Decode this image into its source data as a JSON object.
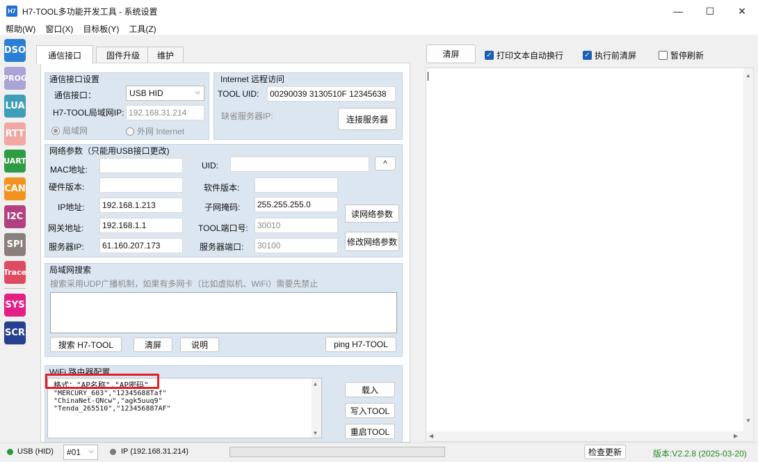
{
  "window": {
    "icon_text": "H7",
    "title": "H7-TOOL多功能开发工具 - 系统设置",
    "minimize": "—",
    "maximize": "☐",
    "close": "✕"
  },
  "menu": [
    "帮助(W)",
    "窗口(X)",
    "目标板(Y)",
    "工具(Z)"
  ],
  "sidebar": [
    {
      "label": "DSO",
      "color": "#2a7fd4"
    },
    {
      "label": "PROG",
      "color": "#a9a3d6"
    },
    {
      "label": "LUA",
      "color": "#3f9fb6"
    },
    {
      "label": "RTT",
      "color": "#f1a7a3"
    },
    {
      "label": "UART",
      "color": "#2f9c44"
    },
    {
      "label": "CAN",
      "color": "#f3931f"
    },
    {
      "label": "I2C",
      "color": "#b4417f"
    },
    {
      "label": "SPI",
      "color": "#8b7f7d"
    },
    {
      "label": "Trace",
      "color": "#e04a61"
    },
    {
      "label": "SYS",
      "color": "#e21f86"
    },
    {
      "label": "SCR",
      "color": "#273f8f"
    }
  ],
  "tabs": [
    "通信接口",
    "固件升级",
    "维护"
  ],
  "comm": {
    "title": "通信接口设置",
    "iface_label": "通信接口：",
    "iface_value": "USB HID",
    "lan_ip_label": "H7-TOOL局域网IP:",
    "lan_ip_value": "192.168.31.214",
    "radio_lan": "局域网",
    "radio_wan": "外网 Internet"
  },
  "internet": {
    "title": "Internet 远程访问",
    "uid_label": "TOOL UID:",
    "uid_value": "00290039 3130510F 12345638",
    "server_label": "缺省服务器IP:",
    "connect_button": "连接服务器"
  },
  "net": {
    "title": "网络参数（只能用USB接口更改)",
    "mac_label": "MAC地址:",
    "mac_value": "",
    "uid_label": "UID:",
    "uid_value": "",
    "uid_button": "^",
    "hw_label": "硬件版本:",
    "hw_value": "",
    "sw_label": "软件版本:",
    "sw_value": "",
    "ip_label": "IP地址:",
    "ip_value": "192.168.1.213",
    "mask_label": "子网掩码:",
    "mask_value": "255.255.255.0",
    "read_button": "读网络参数",
    "gw_label": "网关地址:",
    "gw_value": "192.168.1.1",
    "port_label": "TOOL端口号:",
    "port_value": "30010",
    "server_ip_label": "服务器IP:",
    "server_ip_value": "61.160.207.173",
    "server_port_label": "服务器端口:",
    "server_port_value": "30100",
    "modify_button": "修改网络参数"
  },
  "lan": {
    "title": "局域网搜索",
    "hint": "搜索采用UDP广播机制，如果有多网卡（比如虚拟机、WiFi）需要先禁止",
    "search_button": "搜索 H7-TOOL",
    "clear_button": "清屏",
    "help_button": "说明",
    "ping_button": "ping H7-TOOL"
  },
  "wifi": {
    "title": "WiFi 路由器配置",
    "lines": [
      "格式：\"AP名称\",\"AP密码\"",
      "\"MERCURY_603\",\"12345688Taf\"",
      "\"ChinaNet-QNcw\",\"agk5uuq9\"",
      "\"Tenda_265510\",\"123456887AF\""
    ],
    "load_button": "载入",
    "write_button": "写入TOOL",
    "restart_button": "重启TOOL"
  },
  "output": {
    "clear_button": "清屏",
    "wrap_label": "打印文本自动换行",
    "wrap_checked": true,
    "clear_before_label": "执行前清屏",
    "clear_before_checked": true,
    "pause_label": "暂停刷新",
    "pause_checked": false
  },
  "status": {
    "usb": "USB (HID)",
    "usb_color": "#1e9b3a",
    "device": "#01",
    "ip": "IP (192.168.31.214)",
    "ip_color": "#7a7a7a",
    "check_update": "检查更新",
    "version": "版本:V2.2.8 (2025-03-20)",
    "version_color": "#1f8a1f"
  }
}
